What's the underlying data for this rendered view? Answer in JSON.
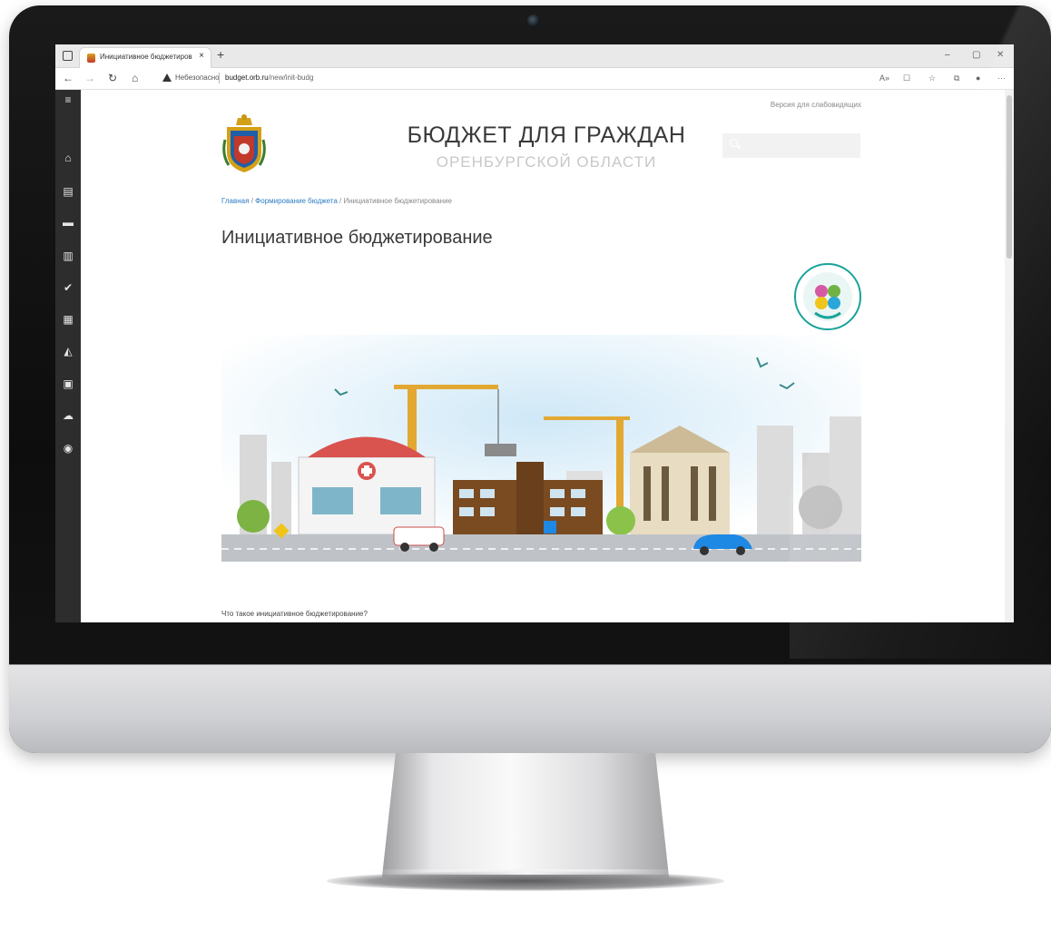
{
  "browser": {
    "tab_title": "Инициативное бюджетирован",
    "tab_close": "×",
    "new_tab": "+",
    "insecure_label": "Небезопасно",
    "url_host": "budget.orb.ru",
    "url_path": "/new/init-budg",
    "window_controls": [
      "–",
      "▢",
      "✕"
    ]
  },
  "sidebar": {
    "items": [
      "menu-icon",
      "home-icon",
      "document-icon",
      "briefcase-icon",
      "bar-chart-icon",
      "check-icon",
      "calculator-icon",
      "area-chart-icon",
      "archive-icon",
      "cloud-upload-icon",
      "user-circle-icon"
    ]
  },
  "header": {
    "accessibility_link": "Версия для слабовидящих",
    "title": "БЮДЖЕТ ДЛЯ ГРАЖДАН",
    "subtitle": "ОРЕНБУРГСКОЙ ОБЛАСТИ"
  },
  "breadcrumb": {
    "home": "Главная",
    "section": "Формирование бюджета",
    "current": "Инициативное бюджетирование",
    "sep": "/"
  },
  "main": {
    "heading": "Инициативное бюджетирование",
    "question": "Что такое инициативное бюджетирование?"
  },
  "colors": {
    "sidebar": "#2d2d2d",
    "link": "#2f7dc2",
    "badge_teal": "#1aa39a"
  }
}
